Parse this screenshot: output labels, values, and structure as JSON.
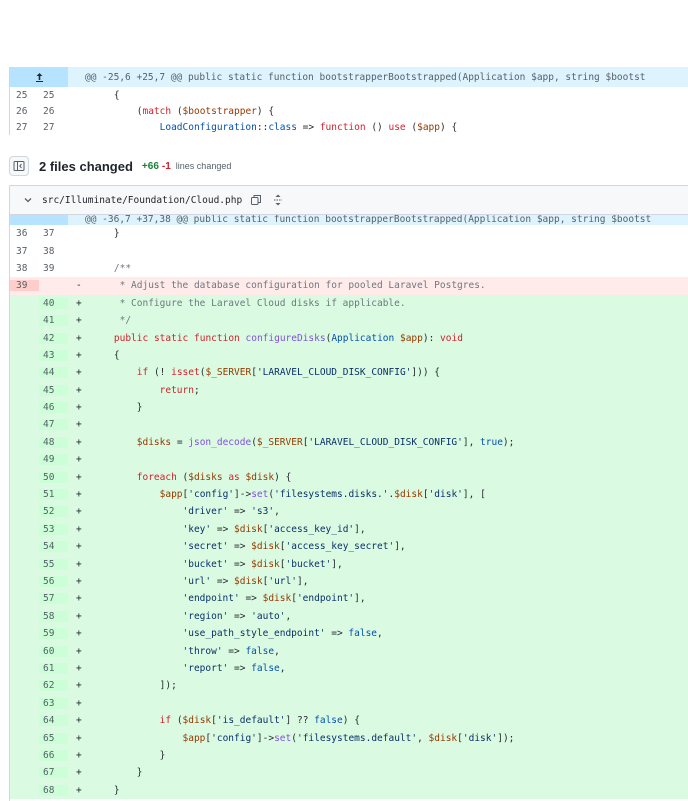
{
  "top_diff": {
    "hunk": "@@ -25,6 +25,7 @@ public static function bootstrapperBootstrapped(Application $app, string $bootst",
    "rows": [
      {
        "old": "25",
        "new": "25",
        "code": "    {"
      },
      {
        "old": "26",
        "new": "26",
        "code": "        (match ($bootstrapper) {"
      },
      {
        "old": "27",
        "new": "27",
        "code": "            LoadConfiguration::class => function () use ($app) {"
      }
    ]
  },
  "summary": {
    "title": "2 files changed",
    "additions": "+66",
    "deletions": "-1",
    "lines_label": "lines changed"
  },
  "file": {
    "path": "src/Illuminate/Foundation/Cloud.php",
    "hunk": "@@ -36,7 +37,38 @@ public static function bootstrapperBootstrapped(Application $app, string $bootst",
    "rows": [
      {
        "type": "ctx",
        "old": "36",
        "new": "37",
        "sign": "",
        "code": "    }"
      },
      {
        "type": "ctx",
        "old": "37",
        "new": "38",
        "sign": "",
        "code": ""
      },
      {
        "type": "ctx",
        "old": "38",
        "new": "39",
        "sign": "",
        "code": "    /**"
      },
      {
        "type": "del",
        "old": "39",
        "new": "",
        "sign": "-",
        "code": "     * Adjust the database configuration for pooled Laravel Postgres."
      },
      {
        "type": "add",
        "old": "",
        "new": "40",
        "sign": "+",
        "code": "     * Configure the Laravel Cloud disks if applicable."
      },
      {
        "type": "add",
        "old": "",
        "new": "41",
        "sign": "+",
        "code": "     */"
      },
      {
        "type": "add",
        "old": "",
        "new": "42",
        "sign": "+",
        "code": "    public static function configureDisks(Application $app): void"
      },
      {
        "type": "add",
        "old": "",
        "new": "43",
        "sign": "+",
        "code": "    {"
      },
      {
        "type": "add",
        "old": "",
        "new": "44",
        "sign": "+",
        "code": "        if (! isset($_SERVER['LARAVEL_CLOUD_DISK_CONFIG'])) {"
      },
      {
        "type": "add",
        "old": "",
        "new": "45",
        "sign": "+",
        "code": "            return;"
      },
      {
        "type": "add",
        "old": "",
        "new": "46",
        "sign": "+",
        "code": "        }"
      },
      {
        "type": "add",
        "old": "",
        "new": "47",
        "sign": "+",
        "code": ""
      },
      {
        "type": "add",
        "old": "",
        "new": "48",
        "sign": "+",
        "code": "        $disks = json_decode($_SERVER['LARAVEL_CLOUD_DISK_CONFIG'], true);"
      },
      {
        "type": "add",
        "old": "",
        "new": "49",
        "sign": "+",
        "code": ""
      },
      {
        "type": "add",
        "old": "",
        "new": "50",
        "sign": "+",
        "code": "        foreach ($disks as $disk) {"
      },
      {
        "type": "add",
        "old": "",
        "new": "51",
        "sign": "+",
        "code": "            $app['config']->set('filesystems.disks.'.$disk['disk'], ["
      },
      {
        "type": "add",
        "old": "",
        "new": "52",
        "sign": "+",
        "code": "                'driver' => 's3',"
      },
      {
        "type": "add",
        "old": "",
        "new": "53",
        "sign": "+",
        "code": "                'key' => $disk['access_key_id'],"
      },
      {
        "type": "add",
        "old": "",
        "new": "54",
        "sign": "+",
        "code": "                'secret' => $disk['access_key_secret'],"
      },
      {
        "type": "add",
        "old": "",
        "new": "55",
        "sign": "+",
        "code": "                'bucket' => $disk['bucket'],"
      },
      {
        "type": "add",
        "old": "",
        "new": "56",
        "sign": "+",
        "code": "                'url' => $disk['url'],"
      },
      {
        "type": "add",
        "old": "",
        "new": "57",
        "sign": "+",
        "code": "                'endpoint' => $disk['endpoint'],"
      },
      {
        "type": "add",
        "old": "",
        "new": "58",
        "sign": "+",
        "code": "                'region' => 'auto',"
      },
      {
        "type": "add",
        "old": "",
        "new": "59",
        "sign": "+",
        "code": "                'use_path_style_endpoint' => false,"
      },
      {
        "type": "add",
        "old": "",
        "new": "60",
        "sign": "+",
        "code": "                'throw' => false,"
      },
      {
        "type": "add",
        "old": "",
        "new": "61",
        "sign": "+",
        "code": "                'report' => false,"
      },
      {
        "type": "add",
        "old": "",
        "new": "62",
        "sign": "+",
        "code": "            ]);"
      },
      {
        "type": "add",
        "old": "",
        "new": "63",
        "sign": "+",
        "code": ""
      },
      {
        "type": "add",
        "old": "",
        "new": "64",
        "sign": "+",
        "code": "            if ($disk['is_default'] ?? false) {"
      },
      {
        "type": "add",
        "old": "",
        "new": "65",
        "sign": "+",
        "code": "                $app['config']->set('filesystems.default', $disk['disk']);"
      },
      {
        "type": "add",
        "old": "",
        "new": "66",
        "sign": "+",
        "code": "            }"
      },
      {
        "type": "add",
        "old": "",
        "new": "67",
        "sign": "+",
        "code": "        }"
      },
      {
        "type": "add",
        "old": "",
        "new": "68",
        "sign": "+",
        "code": "    }"
      }
    ]
  },
  "icons": {
    "hunk_expander": "expand-up-icon",
    "file_tree_toggle": "sidebar-toggle-icon",
    "chevron": "chevron-down-icon",
    "copy": "copy-icon",
    "expand_all": "unfold-icon"
  },
  "colors": {
    "addition_bg": "#dafbe1",
    "addition_gutter": "#ccffd8",
    "deletion_bg": "#ffebe9",
    "deletion_gutter": "#ffcecb",
    "hunk_bg": "#ddf4ff",
    "added_count": "#1a7f37",
    "deleted_count": "#cf222e"
  }
}
